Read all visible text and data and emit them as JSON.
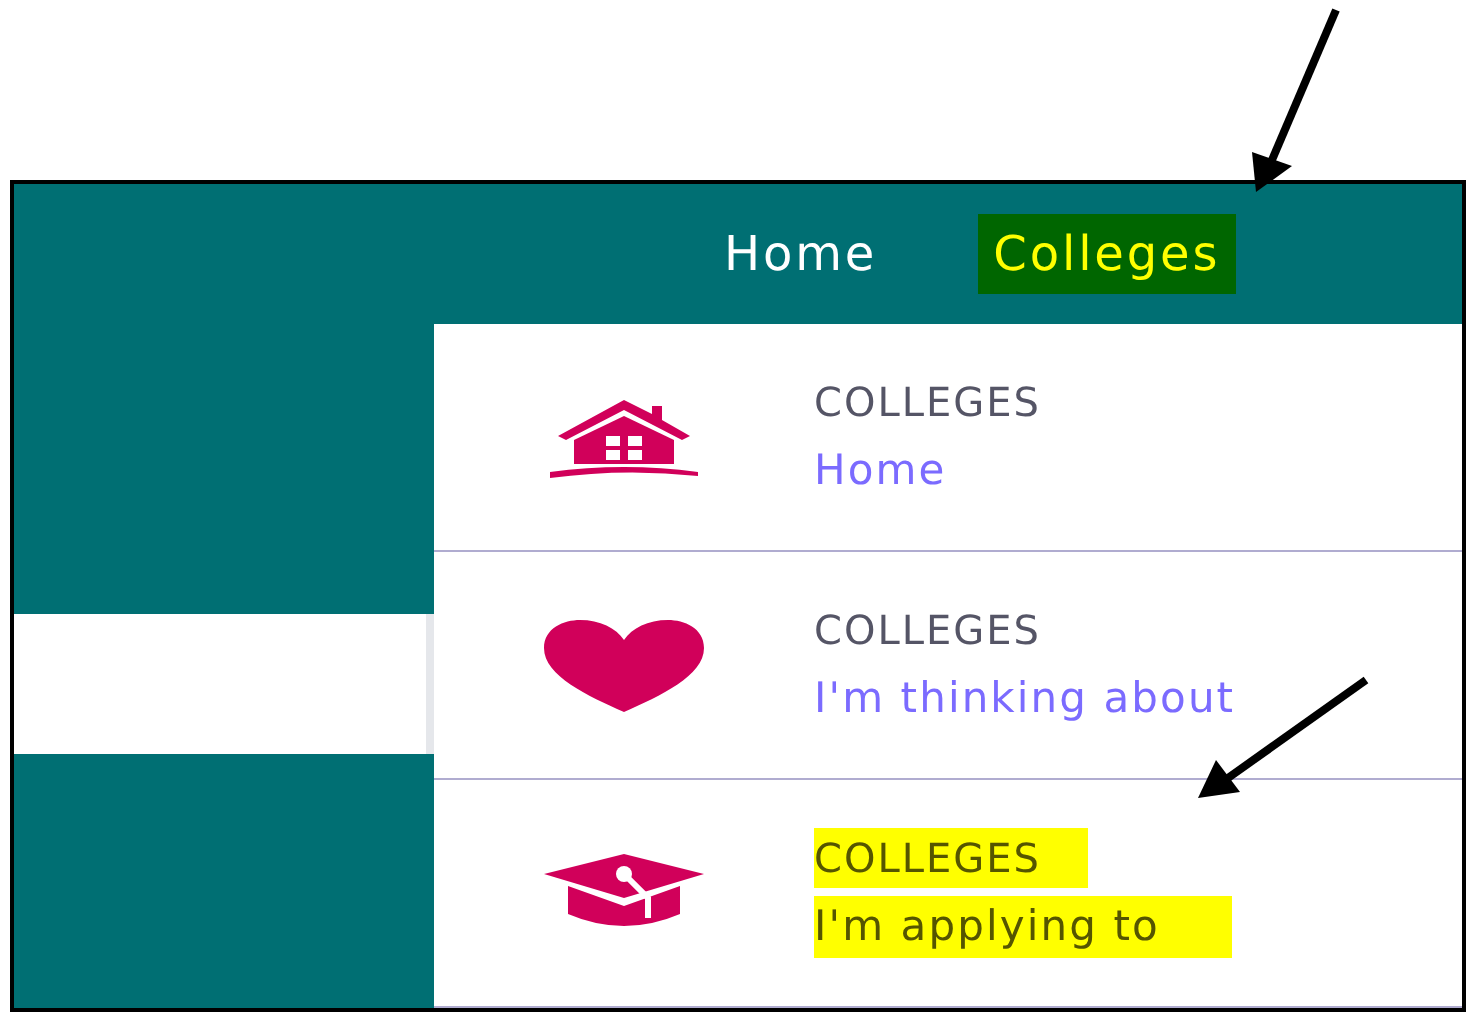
{
  "nav": [
    {
      "label": "Home",
      "highlighted": false
    },
    {
      "label": "Colleges",
      "highlighted": true
    }
  ],
  "menu": [
    {
      "title": "COLLEGES",
      "link": "Home",
      "highlighted": false
    },
    {
      "title": "COLLEGES",
      "link": "I'm thinking about",
      "highlighted": false
    },
    {
      "title": "COLLEGES",
      "link": "I'm applying to",
      "highlighted": true
    }
  ]
}
